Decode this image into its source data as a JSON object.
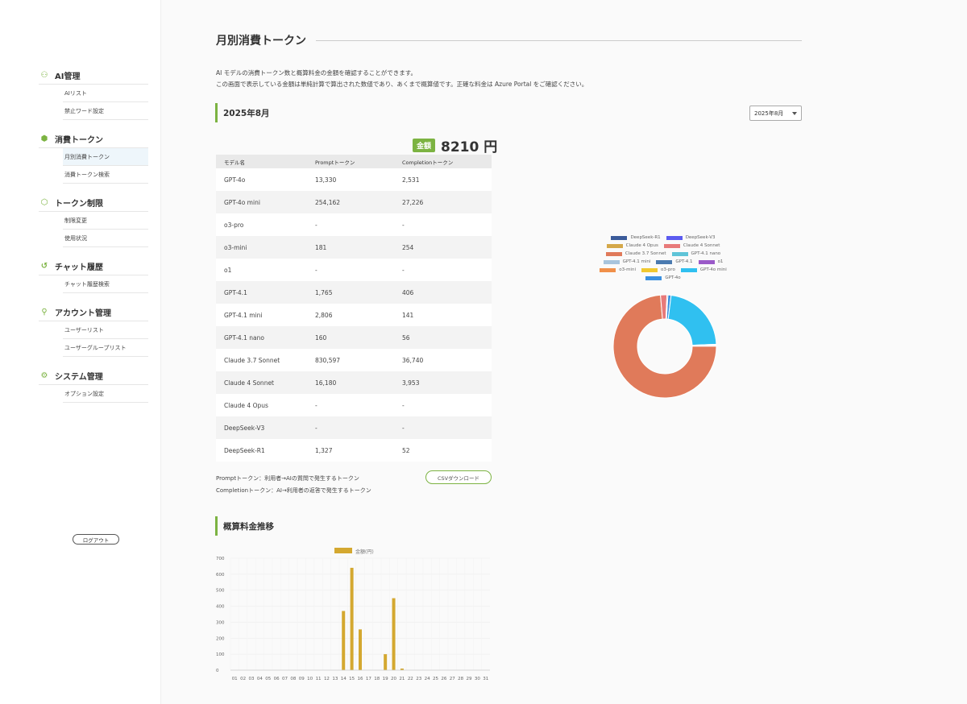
{
  "sidebar": {
    "groups": [
      {
        "icon": "ai-management-icon",
        "label": "AI管理",
        "items": [
          "AIリスト",
          "禁止ワード設定"
        ]
      },
      {
        "icon": "token-cube-icon",
        "label": "消費トークン",
        "items": [
          "月別消費トークン",
          "消費トークン検索"
        ]
      },
      {
        "icon": "token-limit-icon",
        "label": "トークン制限",
        "items": [
          "制限変更",
          "使用状況"
        ]
      },
      {
        "icon": "history-icon",
        "label": "チャット履歴",
        "items": [
          "チャット履歴検索"
        ]
      },
      {
        "icon": "account-icon",
        "label": "アカウント管理",
        "items": [
          "ユーザーリスト",
          "ユーザーグループリスト"
        ]
      },
      {
        "icon": "system-settings-icon",
        "label": "システム管理",
        "items": [
          "オプション設定"
        ]
      }
    ],
    "active_item": "月別消費トークン",
    "logout_label": "ログアウト"
  },
  "main": {
    "title": "月別消費トークン",
    "description_line1": "AI モデルの消費トークン数と概算料金の金額を確認することができます。",
    "description_line2": "この画面で表示している金額は単純計算で算出された数値であり、あくまで概算値です。正確な料金は Azure Portal をご確認ください。",
    "month_heading": "2025年8月",
    "month_select_value": "2025年8月",
    "total_badge": "金額",
    "total_amount": "8210 円",
    "table": {
      "headers": [
        "モデル名",
        "Promptトークン",
        "Completionトークン"
      ],
      "rows": [
        [
          "GPT-4o",
          "13,330",
          "2,531"
        ],
        [
          "GPT-4o mini",
          "254,162",
          "27,226"
        ],
        [
          "o3-pro",
          "-",
          "-"
        ],
        [
          "o3-mini",
          "181",
          "254"
        ],
        [
          "o1",
          "-",
          "-"
        ],
        [
          "GPT-4.1",
          "1,765",
          "406"
        ],
        [
          "GPT-4.1 mini",
          "2,806",
          "141"
        ],
        [
          "GPT-4.1 nano",
          "160",
          "56"
        ],
        [
          "Claude 3.7 Sonnet",
          "830,597",
          "36,740"
        ],
        [
          "Claude 4 Sonnet",
          "16,180",
          "3,953"
        ],
        [
          "Claude 4 Opus",
          "-",
          "-"
        ],
        [
          "DeepSeek-V3",
          "-",
          "-"
        ],
        [
          "DeepSeek-R1",
          "1,327",
          "52"
        ]
      ]
    },
    "note_line1": "Promptトークン：利用者→AIの質問で発生するトークン",
    "note_line2": "Completionトークン：AI→利用者の返答で発生するトークン",
    "csv_button": "CSVダウンロード",
    "trend_heading": "概算料金推移"
  },
  "chart_data": [
    {
      "type": "pie",
      "title": "",
      "legend_position": "top",
      "labels": [
        "DeepSeek-R1",
        "DeepSeek-V3",
        "Claude 4 Opus",
        "Claude 4 Sonnet",
        "Claude 3.7 Sonnet",
        "GPT-4.1 nano",
        "GPT-4.1 mini",
        "GPT-4.1",
        "o1",
        "o3-mini",
        "o3-pro",
        "GPT-4o mini",
        "GPT-4o"
      ],
      "colors": [
        "#3b5b9a",
        "#5b5bf0",
        "#d4a84a",
        "#e87a7a",
        "#e07a5a",
        "#5fc4d8",
        "#a8c4dc",
        "#4a7ab0",
        "#9a5ac8",
        "#f0904a",
        "#f0c830",
        "#30c0f0",
        "#3a90e0"
      ],
      "values": [
        0.3,
        0,
        0,
        2.0,
        73.7,
        0.05,
        0.2,
        0.2,
        0,
        0.15,
        0,
        22.4,
        1.0
      ]
    },
    {
      "type": "bar",
      "title": "",
      "series": [
        {
          "name": "金額(円)",
          "color": "#d4a830",
          "values": [
            0,
            0,
            0,
            0,
            0,
            0,
            0,
            0,
            0,
            0,
            0,
            0,
            0,
            370,
            640,
            255,
            0,
            0,
            100,
            450,
            10,
            0,
            0,
            0,
            0,
            0,
            0,
            0,
            0,
            0,
            0
          ]
        }
      ],
      "categories": [
        "01",
        "02",
        "03",
        "04",
        "05",
        "06",
        "07",
        "08",
        "09",
        "10",
        "11",
        "12",
        "13",
        "14",
        "15",
        "16",
        "17",
        "18",
        "19",
        "20",
        "21",
        "22",
        "23",
        "24",
        "25",
        "26",
        "27",
        "28",
        "29",
        "30",
        "31"
      ],
      "ylim": [
        0,
        700
      ],
      "yticks": [
        0,
        100,
        200,
        300,
        400,
        500,
        600,
        700
      ],
      "grid": true,
      "legend_position": "top"
    }
  ]
}
